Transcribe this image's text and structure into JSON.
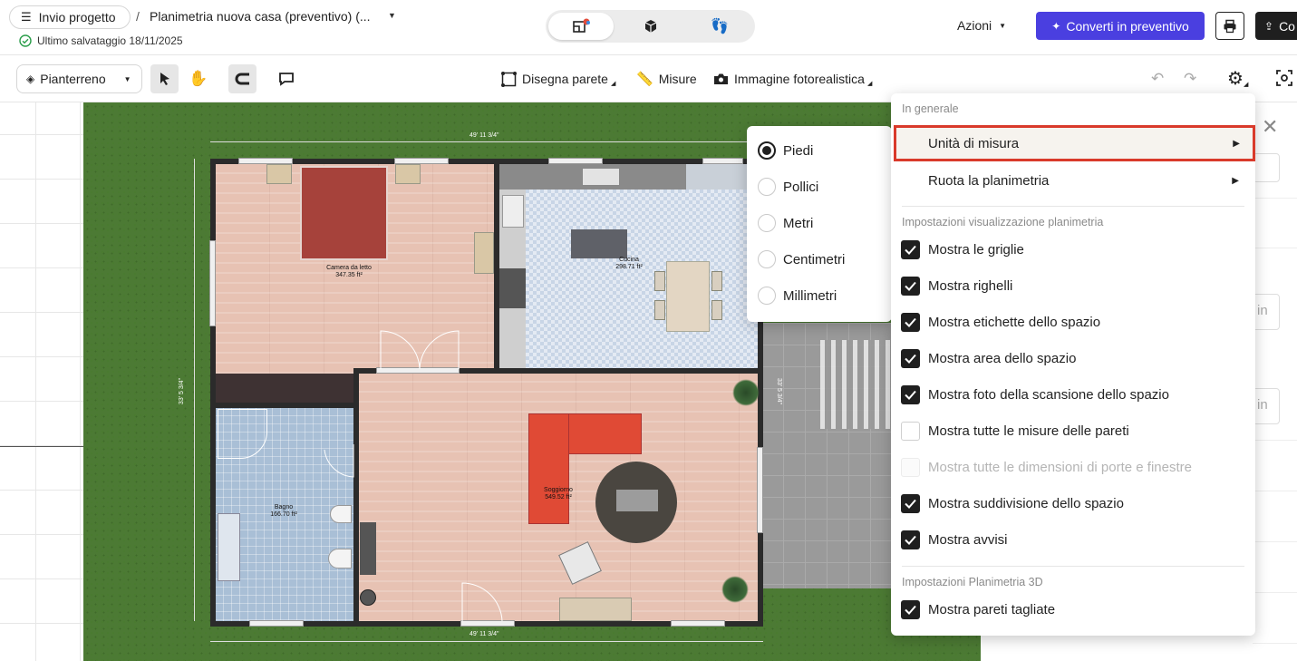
{
  "header": {
    "menu_label": "Invio progetto",
    "separator": "/",
    "project_title": "Planimetria nuova casa (preventivo) (...",
    "save_status": "Ultimo salvataggio 18/11/2025",
    "actions_label": "Azioni",
    "convert_label": "Converti in preventivo",
    "cut_button_label": "Co"
  },
  "toolbar": {
    "floor_label": "Pianterreno",
    "draw_wall_label": "Disegna parete",
    "measures_label": "Misure",
    "photo_label": "Immagine fotorealistica"
  },
  "plan": {
    "rooms": [
      {
        "name": "Camera da letto",
        "area": "347.35 ft²"
      },
      {
        "name": "Cucina",
        "area": "298.71 ft²"
      },
      {
        "name": "Bagno",
        "area": "166.70 ft²"
      },
      {
        "name": "Soggiorno",
        "area": "549.52 ft²"
      }
    ],
    "dim_top": "49' 11 3/4\"",
    "dim_bottom": "49' 11 3/4\"",
    "dim_left": "33' 5 3/4\"",
    "dim_right": "33' 5 3/4\""
  },
  "units_submenu": {
    "options": [
      "Piedi",
      "Pollici",
      "Metri",
      "Centimetri",
      "Millimetri"
    ],
    "selected": "Piedi"
  },
  "settings_menu": {
    "section_general": "In generale",
    "units_label": "Unità di misura",
    "rotate_label": "Ruota la planimetria",
    "section_display": "Impostazioni visualizzazione planimetria",
    "display_options": [
      {
        "label": "Mostra le griglie",
        "state": "checked"
      },
      {
        "label": "Mostra righelli",
        "state": "checked"
      },
      {
        "label": "Mostra etichette dello spazio",
        "state": "checked"
      },
      {
        "label": "Mostra area dello spazio",
        "state": "checked"
      },
      {
        "label": "Mostra foto della scansione dello spazio",
        "state": "checked"
      },
      {
        "label": "Mostra tutte le misure delle pareti",
        "state": "unchecked"
      },
      {
        "label": "Mostra tutte le dimensioni di porte e finestre",
        "state": "disabled"
      },
      {
        "label": "Mostra suddivisione dello spazio",
        "state": "checked"
      },
      {
        "label": "Mostra avvisi",
        "state": "checked"
      }
    ],
    "section_3d": "Impostazioni Planimetria 3D",
    "three_d_options": [
      {
        "label": "Mostra pareti tagliate",
        "state": "checked"
      }
    ]
  },
  "right_panel": {
    "unit_suffix_1": "in",
    "unit_suffix_2": "in"
  },
  "colors": {
    "accent": "#4a3fe0",
    "highlight_border": "#d93a2b",
    "grass": "#4c7a34"
  }
}
